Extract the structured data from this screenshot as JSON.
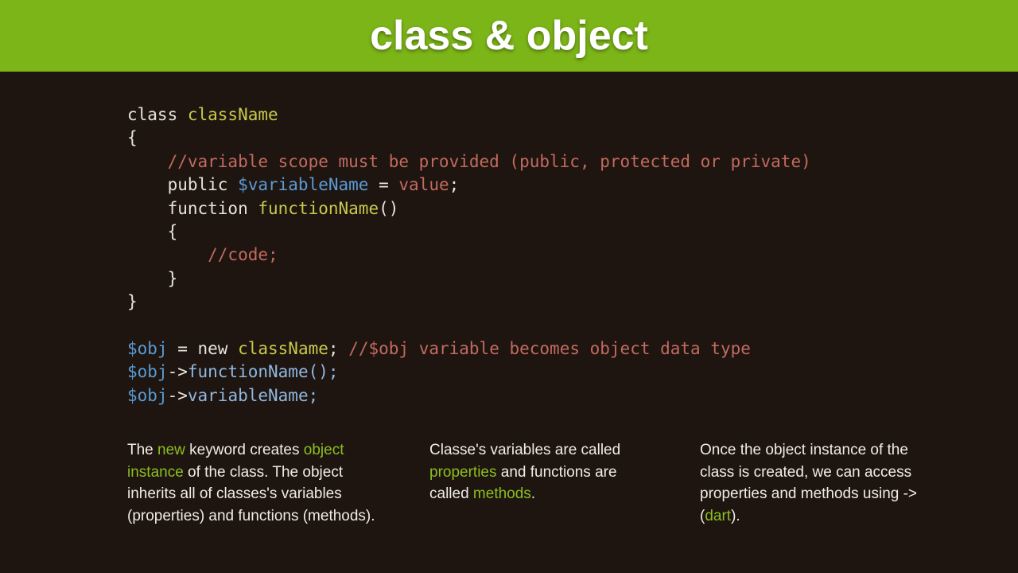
{
  "title": "class & object",
  "code": {
    "l1_kw": "class",
    "l1_name": " className",
    "l2": "{",
    "l3_comment": "    //variable scope must be provided (public, protected or private)",
    "l4_pub": "    public ",
    "l4_var": "$variableName",
    "l4_eq": " = ",
    "l4_val": "value",
    "l4_semi": ";",
    "l5_fun": "    function ",
    "l5_name": "functionName",
    "l5_paren": "()",
    "l6": "    {",
    "l7": "        //code;",
    "l8": "    }",
    "l9": "}",
    "l11_obj": "$obj",
    "l11_eq": " = ",
    "l11_new": "new",
    "l11_cn": " className",
    "l11_semi": "; ",
    "l11_comment": "//$obj variable becomes object data type",
    "l12_obj": "$obj",
    "l12_arrow": "->",
    "l12_fn": "functionName();",
    "l13_obj": "$obj",
    "l13_arrow": "->",
    "l13_var": "variableName;"
  },
  "columns": {
    "c1": {
      "t1": "The ",
      "k1": "new",
      "t2": " keyword creates ",
      "k2": "object instance",
      "t3": " of the class. The object inherits all of classes's variables (properties) and functions (methods)."
    },
    "c2": {
      "t1": "Classe's variables are called ",
      "k1": "properties",
      "t2": " and functions are called ",
      "k2": "methods",
      "t3": "."
    },
    "c3": {
      "t1": "Once the object instance of the class is created, we can access properties and methods using -> (",
      "k1": "dart",
      "t2": ")."
    }
  }
}
